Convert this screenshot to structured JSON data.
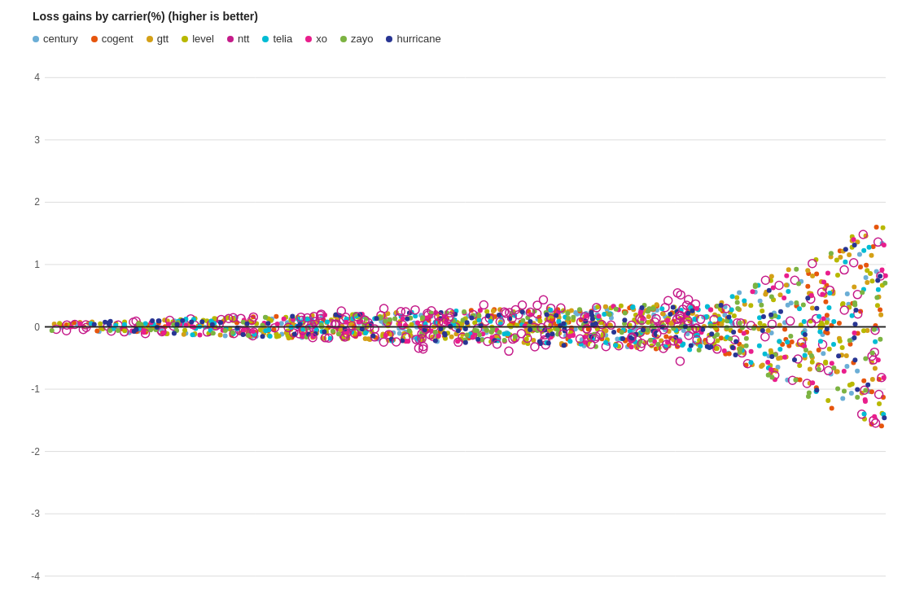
{
  "chart": {
    "title": "Loss gains by carrier(%) (higher is better)",
    "yAxis": {
      "min": -4,
      "max": 4,
      "ticks": [
        -4,
        -3,
        -2,
        -1,
        0,
        1,
        2,
        3,
        4
      ]
    },
    "carriers": [
      {
        "name": "century",
        "color": "#6baed6",
        "ring": false
      },
      {
        "name": "cogent",
        "color": "#e6550d",
        "ring": false
      },
      {
        "name": "gtt",
        "color": "#d4a017",
        "ring": false
      },
      {
        "name": "level",
        "color": "#b8b800",
        "ring": false
      },
      {
        "name": "ntt",
        "color": "#c51b8a",
        "ring": true
      },
      {
        "name": "telia",
        "color": "#00bcd4",
        "ring": false
      },
      {
        "name": "xo",
        "color": "#e91e8c",
        "ring": false
      },
      {
        "name": "zayo",
        "color": "#7cb342",
        "ring": false
      },
      {
        "name": "hurricane",
        "color": "#283593",
        "ring": false
      }
    ]
  }
}
